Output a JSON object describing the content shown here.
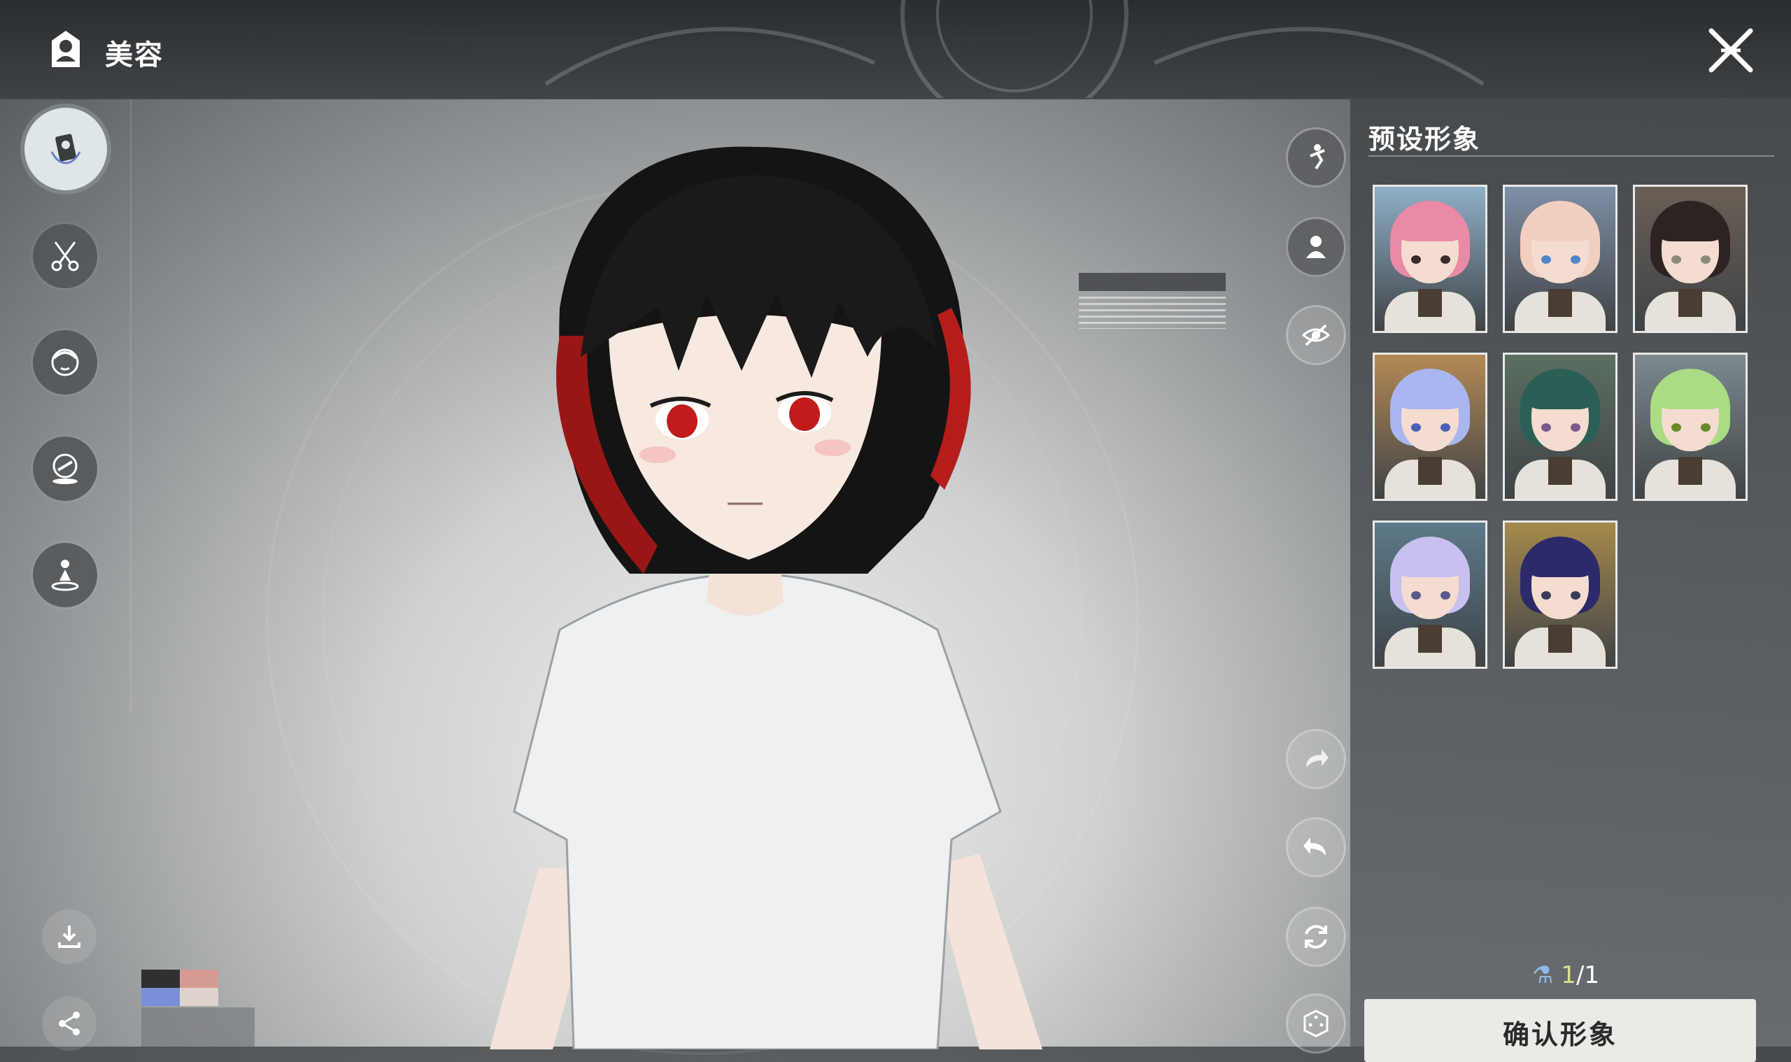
{
  "header": {
    "title": "美容",
    "title_icon": "vanity-mirror-icon",
    "close_icon": "close-icon"
  },
  "sidebar": {
    "items": [
      {
        "name": "portrait-card",
        "icon": "portrait-card-icon",
        "active": true
      },
      {
        "name": "hair",
        "icon": "scissors-comb-icon",
        "active": false
      },
      {
        "name": "face",
        "icon": "face-icon",
        "active": false
      },
      {
        "name": "makeup",
        "icon": "compact-mirror-icon",
        "active": false
      },
      {
        "name": "body",
        "icon": "figure-stand-icon",
        "active": false
      }
    ],
    "bottom": [
      {
        "name": "download",
        "icon": "download-icon"
      },
      {
        "name": "share",
        "icon": "share-icon"
      }
    ]
  },
  "view_tools": {
    "top": [
      {
        "name": "pose",
        "icon": "pose-icon"
      },
      {
        "name": "portrait-view",
        "icon": "portrait-view-icon"
      },
      {
        "name": "hide-ui",
        "icon": "eye-off-icon"
      }
    ],
    "bottom": [
      {
        "name": "redo",
        "icon": "redo-icon"
      },
      {
        "name": "undo",
        "icon": "undo-icon"
      },
      {
        "name": "reset",
        "icon": "refresh-icon"
      },
      {
        "name": "random",
        "icon": "dice-icon"
      }
    ]
  },
  "panel": {
    "title": "预设形象",
    "presets": [
      {
        "hair": "#e98aa6",
        "eye": "#3a2a2a",
        "bg": "#8fb0c8",
        "selected": false
      },
      {
        "hair": "#f2cfc0",
        "eye": "#4f86c9",
        "bg": "#7f8fa6",
        "selected": false
      },
      {
        "hair": "#2d2321",
        "eye": "#8a8a7a",
        "bg": "#6a5f55",
        "selected": false
      },
      {
        "hair": "#a9b6f0",
        "eye": "#4b5fb8",
        "bg": "#b48a55",
        "selected": false
      },
      {
        "hair": "#2b5f55",
        "eye": "#7a5a8a",
        "bg": "#5c6f62",
        "selected": false
      },
      {
        "hair": "#a9dc84",
        "eye": "#6b8a2a",
        "bg": "#7c8a8e",
        "selected": false
      },
      {
        "hair": "#c8c0ee",
        "eye": "#5a5a8a",
        "bg": "#5d7a8a",
        "selected": false
      },
      {
        "hair": "#2c2a6a",
        "eye": "#3a3a5a",
        "bg": "#a58a4c",
        "selected": false
      }
    ],
    "counter": {
      "icon": "potion-icon",
      "current": "1",
      "separator": "/",
      "total": "1"
    },
    "confirm_label": "确认形象"
  },
  "swatches": [
    "#2f3032",
    "#d59a92",
    "#7a8fd8",
    "#e0d2cc"
  ]
}
